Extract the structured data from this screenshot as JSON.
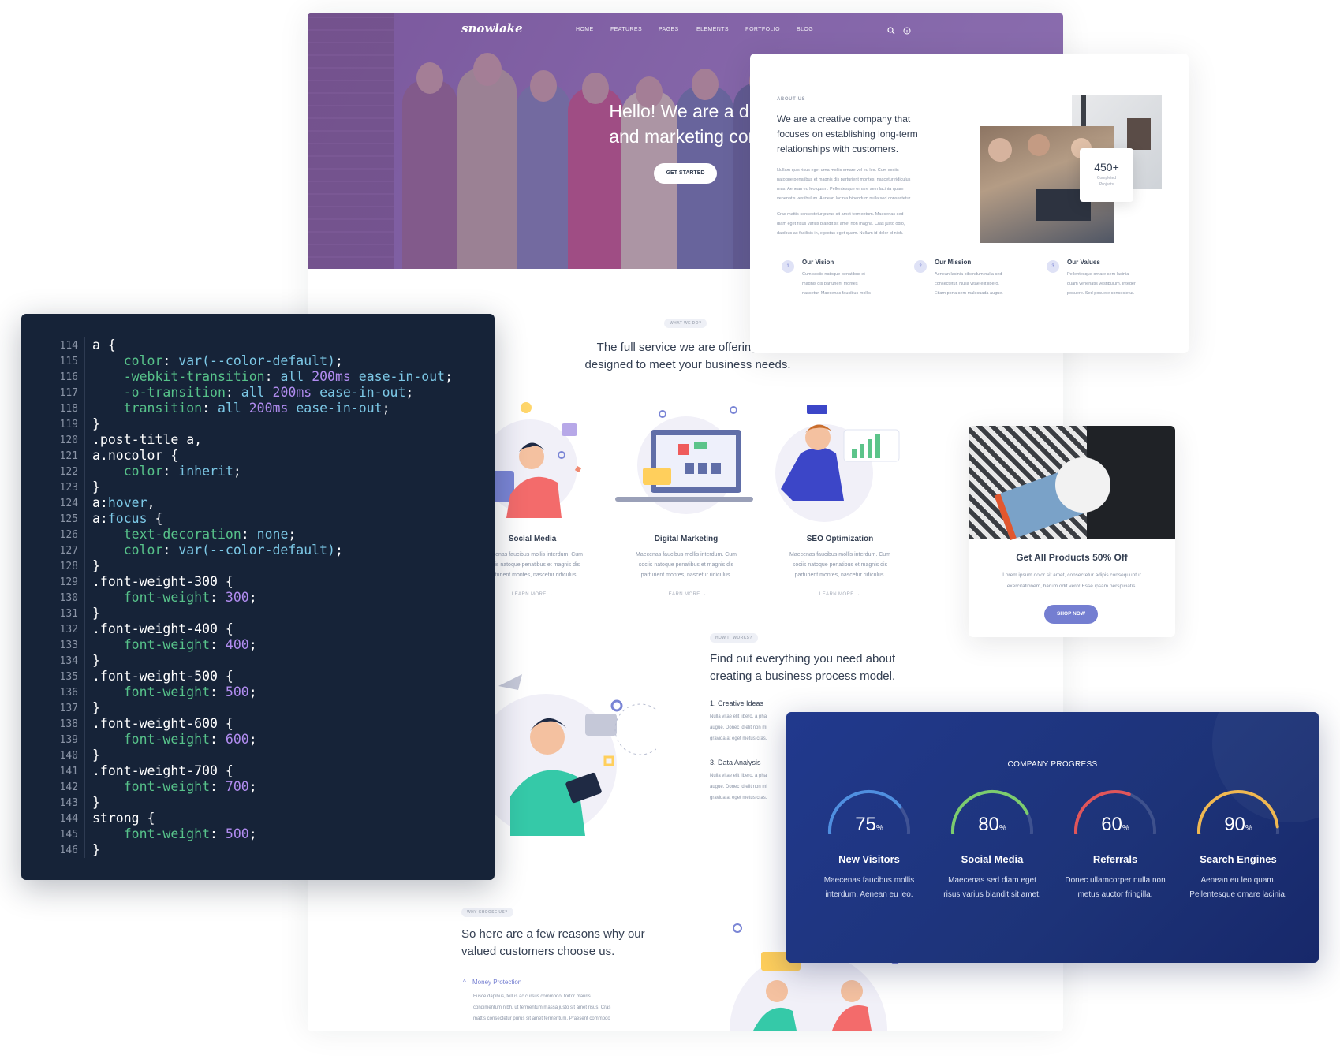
{
  "site": {
    "logo": "snowlake",
    "nav": [
      "HOME",
      "FEATURES",
      "PAGES",
      "ELEMENTS",
      "PORTFOLIO",
      "BLOG"
    ],
    "hero_title_line1": "Hello! We are a dig",
    "hero_title_line2": "and marketing com",
    "hero_button": "GET STARTED"
  },
  "about": {
    "eyebrow": "ABOUT US",
    "heading_lines": [
      "We are a creative company that",
      "focuses on establishing long-term",
      "relationships with customers."
    ],
    "para1_lines": [
      "Nullam quis risus eget urna mollis ornare vel eu leo. Cum sociis",
      "natoque penatibus et magnis dis parturient montes, nascetur ridiculus",
      "mus. Aenean eu leo quam. Pellentesque ornare sem lacinia quam",
      "venenatis vestibulum. Aenean lacinia bibendum nulla sed consectetur."
    ],
    "para2_lines": [
      "Cras mattis consectetur purus sit amet fermentum. Maecenas sed",
      "diam eget risus varius blandit sit amet non magna. Cras justo odio,",
      "dapibus ac facilisis in, egestas eget quam. Nullam id dolor id nibh."
    ],
    "stat_number": "450+",
    "stat_label_lines": [
      "Completed",
      "Projects"
    ],
    "items": [
      {
        "num": "1",
        "title": "Our Vision",
        "lines": [
          "Cum sociis natoque penatibus et",
          "magnis dis parturient montes",
          "nascetur. Maecenas faucibus mollis"
        ]
      },
      {
        "num": "2",
        "title": "Our Mission",
        "lines": [
          "Aenean lacinia bibendum nulla sed",
          "consectetur. Nulla vitae elit libero,",
          "Etiam porta sem malesuada augue."
        ]
      },
      {
        "num": "3",
        "title": "Our Values",
        "lines": [
          "Pellentesque ornare sem lacinia",
          "quam venenatis vestibulum. Integer",
          "posuere. Sed posuere consectetur."
        ]
      }
    ]
  },
  "services": {
    "eyebrow": "WHAT WE DO?",
    "heading_line1": "The full service we are offering is s",
    "heading_line2": "designed to meet your business needs.",
    "items": [
      {
        "title": "Social Media",
        "lines": [
          "Maecenas faucibus mollis interdum. Cum",
          "sociis natoque penatibus et magnis dis",
          "parturient montes, nascetur ridiculus."
        ],
        "link": "LEARN MORE →"
      },
      {
        "title": "Digital Marketing",
        "lines": [
          "Maecenas faucibus mollis interdum. Cum",
          "sociis natoque penatibus et magnis dis",
          "parturient montes, nascetur ridiculus."
        ],
        "link": "LEARN MORE →"
      },
      {
        "title": "SEO Optimization",
        "lines": [
          "Maecenas faucibus mollis interdum. Cum",
          "sociis natoque penatibus et magnis dis",
          "parturient montes, nascetur ridiculus."
        ],
        "link": "LEARN MORE →"
      }
    ]
  },
  "promo": {
    "title": "Get All Products 50% Off",
    "lines": [
      "Lorem ipsum dolor sit amet, consectetur adipis consequuntur",
      "exercitationem, harum odit vero! Esse ipsam perspiciatis."
    ],
    "button": "SHOP NOW"
  },
  "process": {
    "eyebrow": "HOW IT WORKS?",
    "heading_lines": [
      "Find out everything you need about",
      "creating a business process model."
    ],
    "steps": [
      {
        "title": "1. Creative Ideas",
        "lines": [
          "Nulla vitae elit libero, a pha",
          "augue. Donec id elit non mi",
          "gravida at eget metus cras."
        ]
      },
      {
        "title": "3. Data Analysis",
        "lines": [
          "Nulla vitae elit libero, a pha",
          "augue. Donec id elit non mi",
          "gravida at eget metus cras."
        ]
      }
    ]
  },
  "why": {
    "eyebrow": "WHY CHOOSE US?",
    "heading_lines": [
      "So here are a few reasons why our",
      "valued customers choose us."
    ],
    "accordion_title": "Money Protection",
    "accordion_lines": [
      "Fusce dapibus, tellus ac cursus commodo, tortor mauris",
      "condimentum nibh, ut fermentum massa justo sit amet risus. Cras",
      "mattis consectetur purus sit amet fermentum. Praesent commodo"
    ]
  },
  "code": {
    "line_numbers": [
      "114",
      "115",
      "116",
      "117",
      "118",
      "119",
      "120",
      "121",
      "122",
      "123",
      "124",
      "125",
      "126",
      "127",
      "128",
      "129",
      "130",
      "131",
      "132",
      "133",
      "134",
      "135",
      "136",
      "137",
      "138",
      "139",
      "140",
      "141",
      "142",
      "143",
      "144",
      "145",
      "146"
    ],
    "lines": [
      [
        [
          "a {",
          "t"
        ]
      ],
      [
        [
          "    ",
          "t"
        ],
        [
          "color",
          "p"
        ],
        [
          ": ",
          "t"
        ],
        [
          "var(--color-default)",
          "v"
        ],
        [
          ";",
          "t"
        ]
      ],
      [
        [
          "    ",
          "t"
        ],
        [
          "-webkit-transition",
          "p"
        ],
        [
          ": ",
          "t"
        ],
        [
          "all ",
          "v"
        ],
        [
          "200ms",
          "n"
        ],
        [
          " ease-in-out",
          "v"
        ],
        [
          ";",
          "t"
        ]
      ],
      [
        [
          "    ",
          "t"
        ],
        [
          "-o-transition",
          "p"
        ],
        [
          ": ",
          "t"
        ],
        [
          "all ",
          "v"
        ],
        [
          "200ms",
          "n"
        ],
        [
          " ease-in-out",
          "v"
        ],
        [
          ";",
          "t"
        ]
      ],
      [
        [
          "    ",
          "t"
        ],
        [
          "transition",
          "p"
        ],
        [
          ": ",
          "t"
        ],
        [
          "all ",
          "v"
        ],
        [
          "200ms",
          "n"
        ],
        [
          " ease-in-out",
          "v"
        ],
        [
          ";",
          "t"
        ]
      ],
      [
        [
          "}",
          "t"
        ]
      ],
      [
        [
          ".post-title a,",
          "t"
        ]
      ],
      [
        [
          "a.nocolor {",
          "t"
        ]
      ],
      [
        [
          "    ",
          "t"
        ],
        [
          "color",
          "p"
        ],
        [
          ": ",
          "t"
        ],
        [
          "inherit",
          "v"
        ],
        [
          ";",
          "t"
        ]
      ],
      [
        [
          "}",
          "t"
        ]
      ],
      [
        [
          "a:",
          "t"
        ],
        [
          "hover",
          "v"
        ],
        [
          ",",
          "t"
        ]
      ],
      [
        [
          "a:",
          "t"
        ],
        [
          "focus",
          "v"
        ],
        [
          " {",
          "t"
        ]
      ],
      [
        [
          "    ",
          "t"
        ],
        [
          "text-decoration",
          "p"
        ],
        [
          ": ",
          "t"
        ],
        [
          "none",
          "v"
        ],
        [
          ";",
          "t"
        ]
      ],
      [
        [
          "    ",
          "t"
        ],
        [
          "color",
          "p"
        ],
        [
          ": ",
          "t"
        ],
        [
          "var(--color-default)",
          "v"
        ],
        [
          ";",
          "t"
        ]
      ],
      [
        [
          "}",
          "t"
        ]
      ],
      [
        [
          ".font-weight-300 {",
          "t"
        ]
      ],
      [
        [
          "    ",
          "t"
        ],
        [
          "font-weight",
          "p"
        ],
        [
          ": ",
          "t"
        ],
        [
          "300",
          "n"
        ],
        [
          ";",
          "t"
        ]
      ],
      [
        [
          "}",
          "t"
        ]
      ],
      [
        [
          ".font-weight-400 {",
          "t"
        ]
      ],
      [
        [
          "    ",
          "t"
        ],
        [
          "font-weight",
          "p"
        ],
        [
          ": ",
          "t"
        ],
        [
          "400",
          "n"
        ],
        [
          ";",
          "t"
        ]
      ],
      [
        [
          "}",
          "t"
        ]
      ],
      [
        [
          ".font-weight-500 {",
          "t"
        ]
      ],
      [
        [
          "    ",
          "t"
        ],
        [
          "font-weight",
          "p"
        ],
        [
          ": ",
          "t"
        ],
        [
          "500",
          "n"
        ],
        [
          ";",
          "t"
        ]
      ],
      [
        [
          "}",
          "t"
        ]
      ],
      [
        [
          ".font-weight-600 {",
          "t"
        ]
      ],
      [
        [
          "    ",
          "t"
        ],
        [
          "font-weight",
          "p"
        ],
        [
          ": ",
          "t"
        ],
        [
          "600",
          "n"
        ],
        [
          ";",
          "t"
        ]
      ],
      [
        [
          "}",
          "t"
        ]
      ],
      [
        [
          ".font-weight-700 {",
          "t"
        ]
      ],
      [
        [
          "    ",
          "t"
        ],
        [
          "font-weight",
          "p"
        ],
        [
          ": ",
          "t"
        ],
        [
          "700",
          "n"
        ],
        [
          ";",
          "t"
        ]
      ],
      [
        [
          "}",
          "t"
        ]
      ],
      [
        [
          "strong {",
          "t"
        ]
      ],
      [
        [
          "    ",
          "t"
        ],
        [
          "font-weight",
          "p"
        ],
        [
          ": ",
          "t"
        ],
        [
          "500",
          "n"
        ],
        [
          ";",
          "t"
        ]
      ],
      [
        [
          "}",
          "t"
        ]
      ]
    ]
  },
  "progress": {
    "title": "COMPANY PROGRESS",
    "items": [
      {
        "value": 75,
        "unit": "%",
        "label": "New Visitors",
        "lines": [
          "Maecenas faucibus mollis",
          "interdum. Aenean eu leo."
        ],
        "color": "#4f8fe0"
      },
      {
        "value": 80,
        "unit": "%",
        "label": "Social Media",
        "lines": [
          "Maecenas sed diam eget",
          "risus varius blandit sit amet."
        ],
        "color": "#7ccc6e"
      },
      {
        "value": 60,
        "unit": "%",
        "label": "Referrals",
        "lines": [
          "Donec ullamcorper nulla non",
          "metus auctor fringilla."
        ],
        "color": "#e0555a"
      },
      {
        "value": 90,
        "unit": "%",
        "label": "Search Engines",
        "lines": [
          "Aenean eu leo quam.",
          "Pellentesque ornare lacinia."
        ],
        "color": "#f0b851"
      }
    ]
  },
  "colors": {
    "accent": "#747ed1",
    "code_bg": "#162338",
    "progress_bg": "#21398d"
  }
}
